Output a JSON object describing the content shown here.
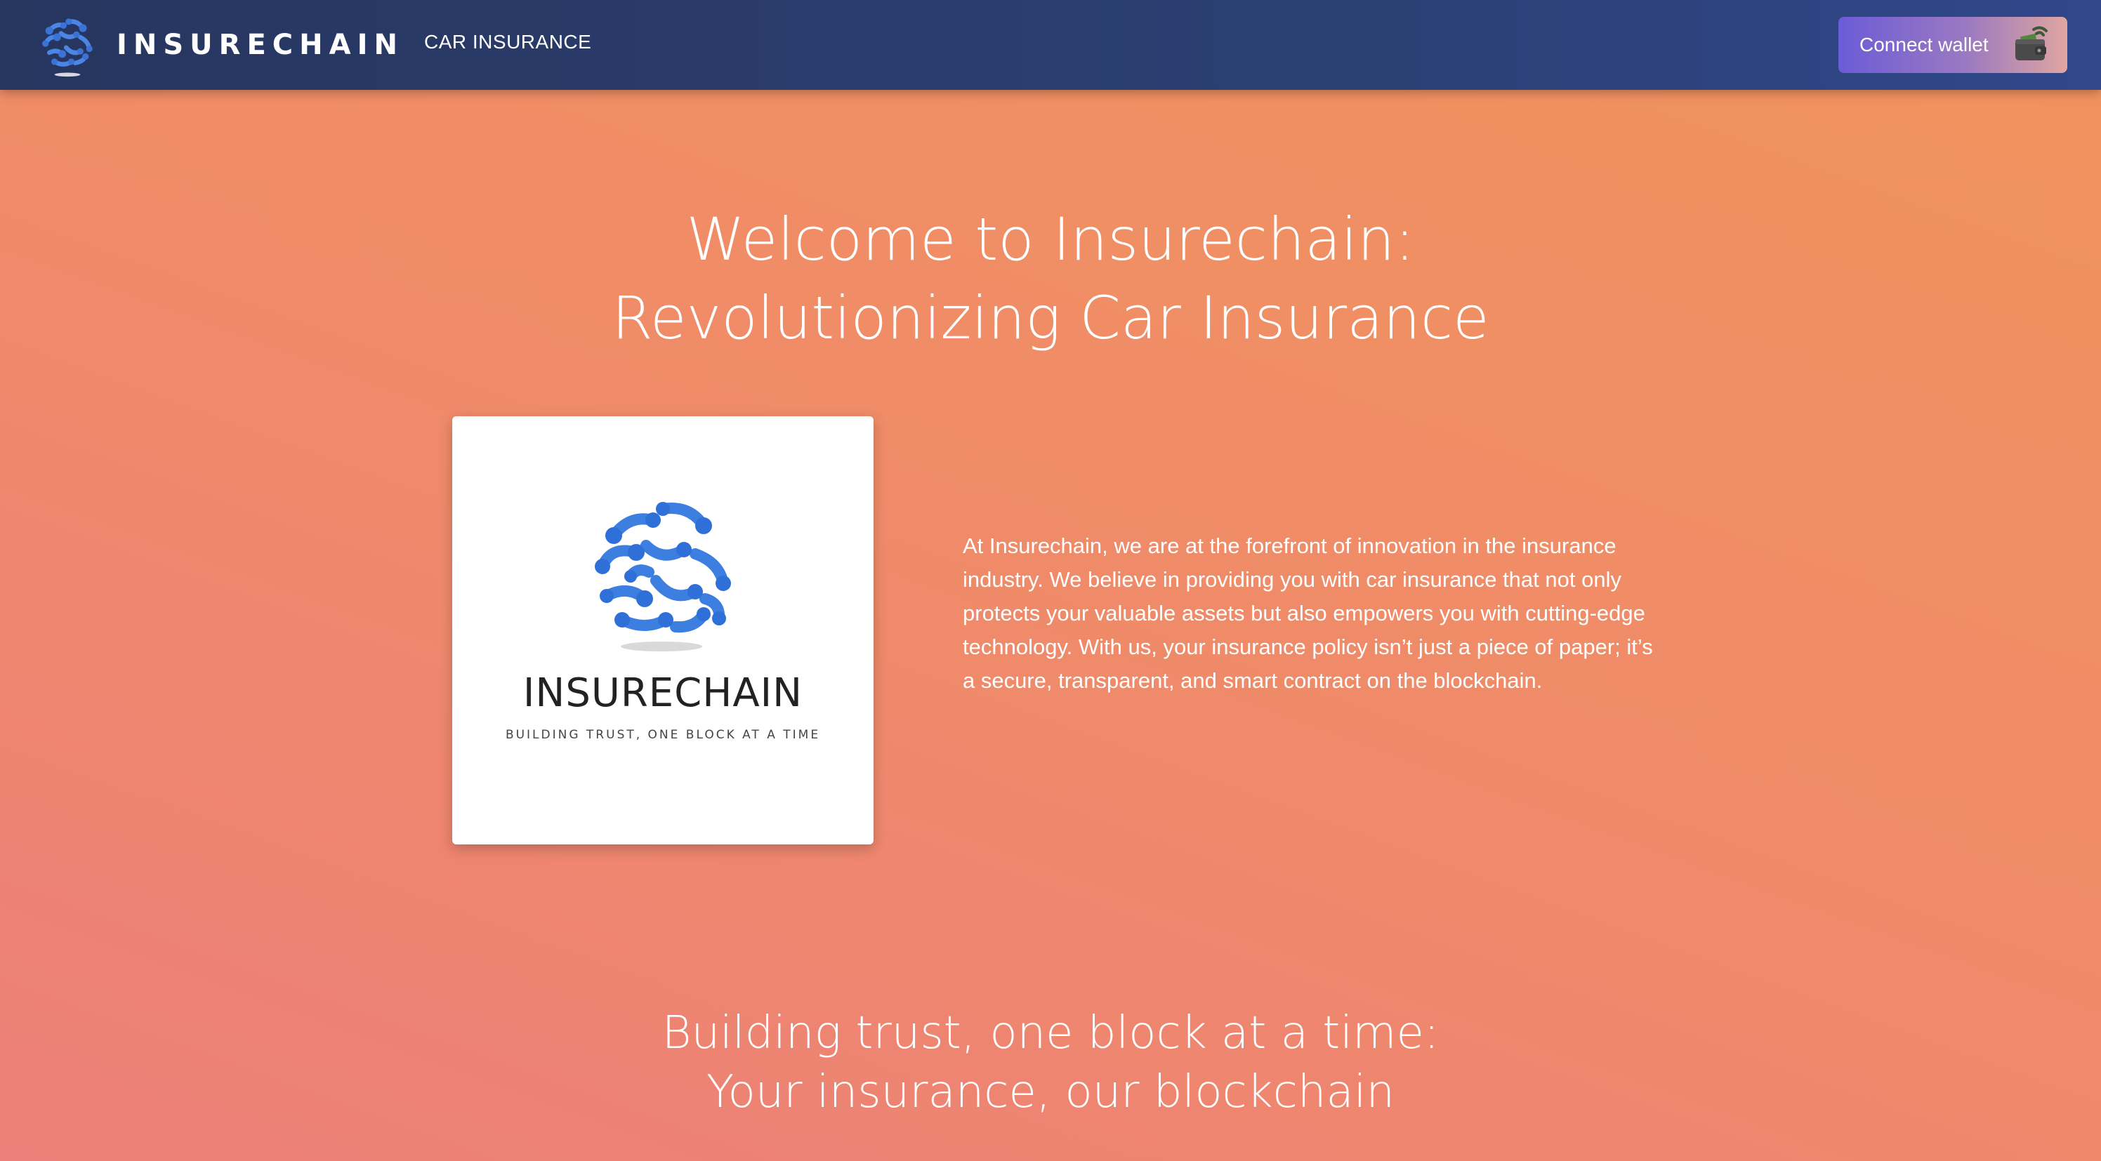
{
  "navbar": {
    "brand_name": "INSURECHAIN",
    "nav_link": "CAR INSURANCE",
    "connect_button_label": "Connect wallet",
    "logo_icon": "globe-network-icon",
    "wallet_icon": "wallet-icon"
  },
  "hero": {
    "title_line1": "Welcome to Insurechain:",
    "title_line2": "Revolutionizing Car Insurance"
  },
  "logo_card": {
    "brand_name": "INSURECHAIN",
    "tagline": "BUILDING TRUST, ONE BLOCK AT A TIME"
  },
  "about": {
    "text": "At Insurechain, we are at the forefront of innovation in the insurance industry. We believe in providing you with car insurance that not only protects your valuable assets but also empowers you with cutting-edge technology. With us, your insurance policy isn’t just a piece of paper; it’s a secure, transparent, and smart contract on the blockchain."
  },
  "tagline_section": {
    "line1": "Building trust, one block at a time:",
    "line2": "Your insurance, our blockchain"
  },
  "colors": {
    "navbar": "#2c3f72",
    "background_start": "#ec7f79",
    "background_end": "#f1935d",
    "globe_blue": "#3d7fe0",
    "button_start": "#6b5cd6",
    "button_end": "#e0a6a0"
  }
}
